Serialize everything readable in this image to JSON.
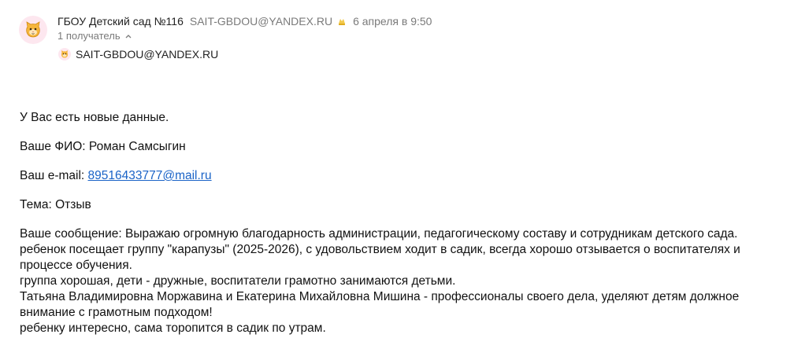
{
  "sender": {
    "name": "ГБОУ Детский сад №116",
    "email": "SAIT-GBDOU@YANDEX.RU",
    "date": "6 апреля в 9:50"
  },
  "recipients": {
    "toggle_label": "1 получатель",
    "items": [
      {
        "email": "SAIT-GBDOU@YANDEX.RU"
      }
    ]
  },
  "body": {
    "intro": "У Вас есть новые данные.",
    "fio": "Ваше ФИО: Роман Самсыгин",
    "email_prefix": "Ваш e-mail: ",
    "email_link": "89516433777@mail.ru",
    "topic": "Тема: Отзыв",
    "message_lines": [
      "Ваше сообщение: Выражаю огромную благодарность администрации, педагогическому составу и сотрудникам детского сада.",
      "ребенок посещает группу \"карапузы\" (2025-2026), с удовольствием ходит в садик, всегда хорошо отзывается о воспитателях и процессе обучения.",
      "группа хорошая, дети - дружные, воспитатели грамотно занимаются детьми.",
      "Татьяна Владимировна Моржавина и Екатерина Михайловна Мишина - профессионалы своего дела, уделяют детям должное внимание с грамотным подходом!",
      "ребенку интересно, сама торопится в садик по утрам."
    ]
  },
  "colors": {
    "link": "#1a63c7",
    "muted": "#7a7a7a",
    "avatar_bg": "#fde7ef"
  }
}
